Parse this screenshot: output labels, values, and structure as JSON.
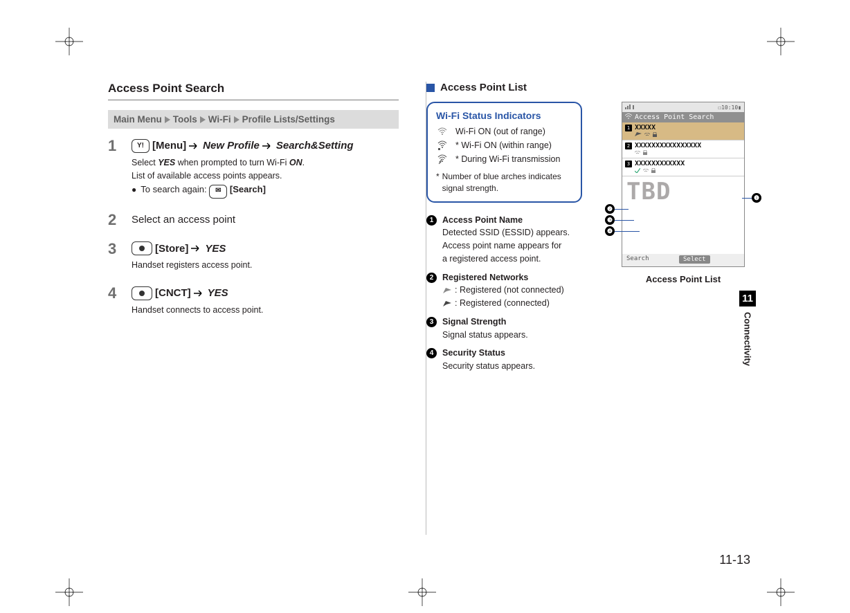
{
  "left": {
    "section_title": "Access Point Search",
    "breadcrumb": [
      "Main Menu",
      "Tools",
      "Wi-Fi",
      "Profile Lists/Settings"
    ],
    "steps": [
      {
        "num": "1",
        "icon_label": "Y!",
        "head_parts": [
          "[Menu]",
          "New Profile",
          "Search&Setting"
        ],
        "body": "Select YES when prompted to turn Wi-Fi ON.",
        "body2": "List of available access points appears.",
        "bullet_prefix": "To search again:",
        "bullet_icon_sym": "✉",
        "bullet_suffix": "[Search]"
      },
      {
        "num": "2",
        "head_plain": "Select an access point"
      },
      {
        "num": "3",
        "icon_type": "dot",
        "head_parts": [
          "[Store]",
          "YES"
        ],
        "body": "Handset registers access point."
      },
      {
        "num": "4",
        "icon_type": "dot",
        "head_parts": [
          "[CNCT]",
          "YES"
        ],
        "body": "Handset connects to access point."
      }
    ]
  },
  "right": {
    "list_heading": "Access Point List",
    "wifi_box": {
      "title": "Wi-Fi Status Indicators",
      "rows": [
        {
          "star": "",
          "text": "Wi-Fi ON (out of range)"
        },
        {
          "star": "*",
          "text": "Wi-Fi ON (within range)"
        },
        {
          "star": "*",
          "text": "During Wi-Fi transmission"
        }
      ],
      "note_star": "*",
      "note": "Number of blue arches indicates signal strength."
    },
    "callouts": [
      {
        "n": "1",
        "title": "Access Point Name",
        "lines": [
          "Detected SSID (ESSID) appears.",
          "Access point name appears for",
          "a registered access point."
        ]
      },
      {
        "n": "2",
        "title": "Registered Networks",
        "iconlines": [
          {
            "text": ": Registered (not connected)"
          },
          {
            "text": ": Registered (connected)"
          }
        ]
      },
      {
        "n": "3",
        "title": "Signal Strength",
        "lines": [
          "Signal status appears."
        ]
      },
      {
        "n": "4",
        "title": "Security Status",
        "lines": [
          "Security status appears."
        ]
      }
    ],
    "phone": {
      "time": "10:10",
      "title": "Access Point Search",
      "rows": [
        {
          "n": "1",
          "name": "XXXXX",
          "hl": true
        },
        {
          "n": "2",
          "name": "XXXXXXXXXXXXXXXX",
          "hl": false
        },
        {
          "n": "3",
          "name": "XXXXXXXXXXXX",
          "hl": false
        }
      ],
      "tbd": "TBD",
      "sk_left": "Search",
      "sk_center": "Select",
      "caption": "Access Point List"
    }
  },
  "side": {
    "chapter_num": "11",
    "chapter_name": "Connectivity"
  },
  "page_number": "11-13"
}
